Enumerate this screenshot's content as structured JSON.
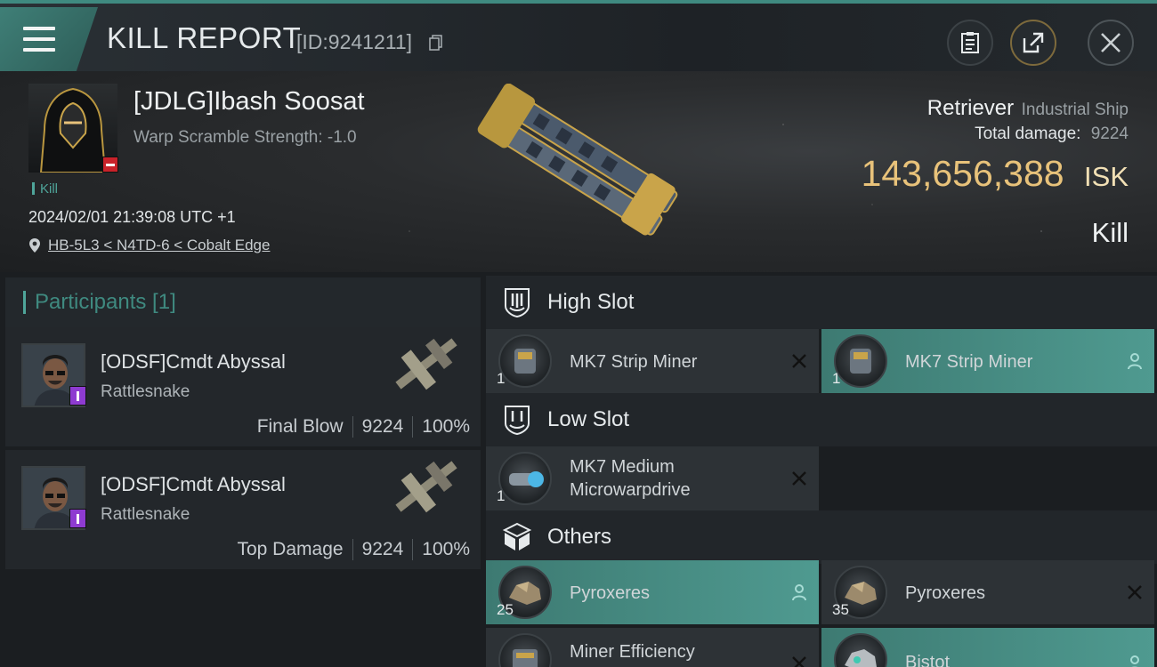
{
  "header": {
    "title": "KILL REPORT",
    "report_id": "[ID:9241211]"
  },
  "victim": {
    "name": "[JDLG]Ibash Soosat",
    "warp_scramble": "Warp Scramble Strength: -1.0",
    "kill_tag": "Kill",
    "datetime": "2024/02/01 21:39:08 UTC +1",
    "location": "HB-5L3 < N4TD-6 < Cobalt Edge",
    "ship_name": "Retriever",
    "ship_class": "Industrial Ship",
    "total_damage_label": "Total damage:",
    "total_damage": "9224",
    "isk_value": "143,656,388",
    "isk_unit": "ISK",
    "result": "Kill"
  },
  "participants": {
    "title": "Participants [1]",
    "items": [
      {
        "name": "[ODSF]Cmdt Abyssal",
        "ship": "Rattlesnake",
        "role": "Final Blow",
        "damage": "9224",
        "percent": "100%"
      },
      {
        "name": "[ODSF]Cmdt Abyssal",
        "ship": "Rattlesnake",
        "role": "Top Damage",
        "damage": "9224",
        "percent": "100%"
      }
    ]
  },
  "slots": {
    "high": {
      "title": "High Slot",
      "items": [
        {
          "name": "MK7 Strip Miner",
          "qty": "1",
          "state": "destroyed"
        },
        {
          "name": "MK7 Strip Miner",
          "qty": "1",
          "state": "dropped"
        }
      ]
    },
    "low": {
      "title": "Low Slot",
      "items": [
        {
          "name_line1": "MK7 Medium",
          "name_line2": "Microwarpdrive",
          "qty": "1",
          "state": "destroyed"
        }
      ]
    },
    "others": {
      "title": "Others",
      "items": [
        {
          "name": "Pyroxeres",
          "qty": "25",
          "state": "dropped"
        },
        {
          "name": "Pyroxeres",
          "qty": "35",
          "state": "destroyed"
        },
        {
          "name": "Miner Efficiency",
          "qty": "",
          "state": "destroyed"
        },
        {
          "name": "Bistot",
          "qty": "",
          "state": "dropped"
        }
      ]
    }
  },
  "colors": {
    "accent_teal": "#3f8a80",
    "isk_gold": "#e8c27a",
    "victim_badge_red": "#c9222a",
    "participant_badge_purple": "#8e3bd1"
  },
  "icons": {
    "menu": "hamburger-menu-icon",
    "copy": "copy-icon",
    "report": "clipboard-icon",
    "share": "share-icon",
    "close": "close-icon",
    "location": "map-pin-icon",
    "high_slot": "high-slot-shield-icon",
    "low_slot": "low-slot-shield-icon",
    "others": "cube-icon",
    "destroyed": "x-mark-icon",
    "dropped": "person-icon"
  }
}
